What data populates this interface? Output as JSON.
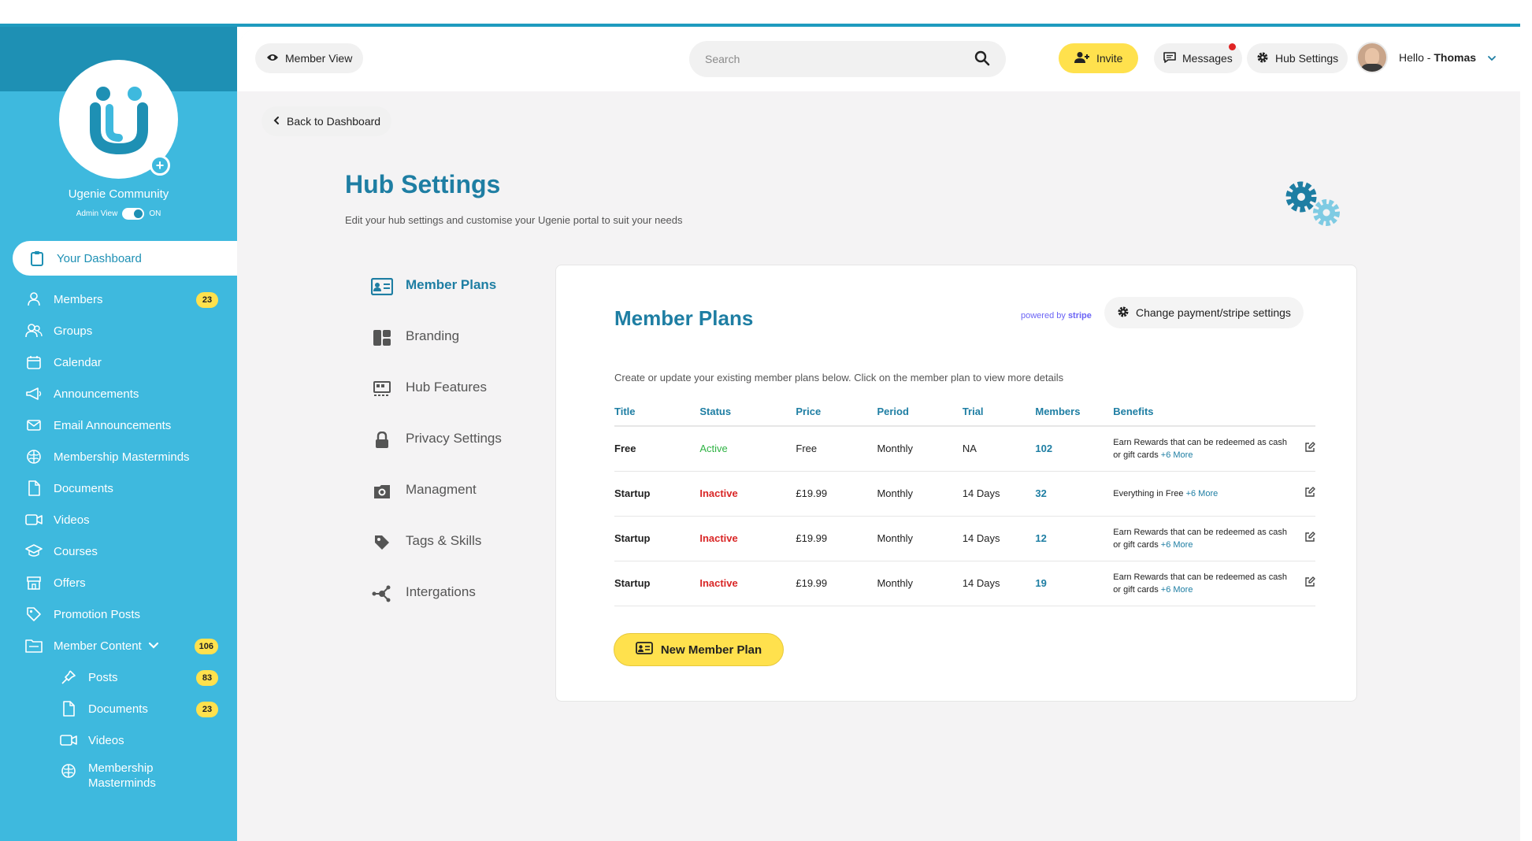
{
  "colors": {
    "accent": "#1e7ea3",
    "sidebar": "#3eb9de",
    "sidebar_dark": "#1e90b4",
    "highlight": "#ffe14d",
    "active_status": "#2fb344",
    "inactive_status": "#d92626"
  },
  "sidebar": {
    "community_name": "Ugenie Community",
    "admin_view_label": "Admin View",
    "admin_view_state": "ON",
    "items": [
      {
        "label": "Your Dashboard",
        "icon": "clipboard-icon"
      },
      {
        "label": "Members",
        "icon": "user-icon",
        "badge": "23"
      },
      {
        "label": "Groups",
        "icon": "users-icon"
      },
      {
        "label": "Calendar",
        "icon": "calendar-icon"
      },
      {
        "label": "Announcements",
        "icon": "megaphone-icon"
      },
      {
        "label": "Email Announcements",
        "icon": "mail-icon"
      },
      {
        "label": "Membership Masterminds",
        "icon": "brain-icon"
      },
      {
        "label": "Documents",
        "icon": "document-icon"
      },
      {
        "label": "Videos",
        "icon": "video-icon"
      },
      {
        "label": "Courses",
        "icon": "graduation-cap-icon"
      },
      {
        "label": "Offers",
        "icon": "store-icon"
      },
      {
        "label": "Promotion Posts",
        "icon": "tag-icon"
      },
      {
        "label": "Member Content",
        "icon": "folder-icon",
        "badge": "106"
      }
    ],
    "sub_items": [
      {
        "label": "Posts",
        "icon": "pin-icon",
        "badge": "83"
      },
      {
        "label": "Documents",
        "icon": "document-icon",
        "badge": "23"
      },
      {
        "label": "Videos",
        "icon": "video-icon"
      },
      {
        "label": "Membership Masterminds",
        "icon": "brain-icon"
      }
    ]
  },
  "header": {
    "member_view": "Member View",
    "search_placeholder": "Search",
    "invite": "Invite",
    "messages": "Messages",
    "hub_settings": "Hub Settings",
    "greeting": "Hello - ",
    "user_name": "Thomas"
  },
  "page": {
    "back_label": "Back to Dashboard",
    "title": "Hub Settings",
    "subtitle": "Edit your hub settings and customise your Ugenie portal to suit your needs"
  },
  "settings_menu": [
    {
      "label": "Member Plans",
      "icon": "id-card-icon"
    },
    {
      "label": "Branding",
      "icon": "branding-icon"
    },
    {
      "label": "Hub Features",
      "icon": "features-icon"
    },
    {
      "label": "Privacy Settings",
      "icon": "lock-icon"
    },
    {
      "label": "Managment",
      "icon": "management-icon"
    },
    {
      "label": "Tags & Skills",
      "icon": "tag-icon"
    },
    {
      "label": "Intergations",
      "icon": "integrations-icon"
    }
  ],
  "plans_card": {
    "title": "Member Plans",
    "powered_by": "powered by",
    "stripe": "stripe",
    "stripe_button": "Change payment/stripe settings",
    "description": "Create or update your existing member plans below. Click on the member plan to view more details",
    "columns": [
      "Title",
      "Status",
      "Price",
      "Period",
      "Trial",
      "Members",
      "Benefits"
    ],
    "rows": [
      {
        "title": "Free",
        "status": "Active",
        "price": "Free",
        "period": "Monthly",
        "trial": "NA",
        "members": "102",
        "benefits": "Earn Rewards that can be redeemed as cash or gift cards",
        "more": "+6 More"
      },
      {
        "title": "Startup",
        "status": "Inactive",
        "price": "£19.99",
        "period": "Monthly",
        "trial": "14 Days",
        "members": "32",
        "benefits": "Everything in Free",
        "more": "+6 More"
      },
      {
        "title": "Startup",
        "status": "Inactive",
        "price": "£19.99",
        "period": "Monthly",
        "trial": "14 Days",
        "members": "12",
        "benefits": "Earn Rewards that can be redeemed as cash or gift cards",
        "more": "+6 More"
      },
      {
        "title": "Startup",
        "status": "Inactive",
        "price": "£19.99",
        "period": "Monthly",
        "trial": "14 Days",
        "members": "19",
        "benefits": "Earn Rewards that can be redeemed as cash or gift cards",
        "more": "+6 More"
      }
    ],
    "new_plan_button": "New Member Plan"
  }
}
